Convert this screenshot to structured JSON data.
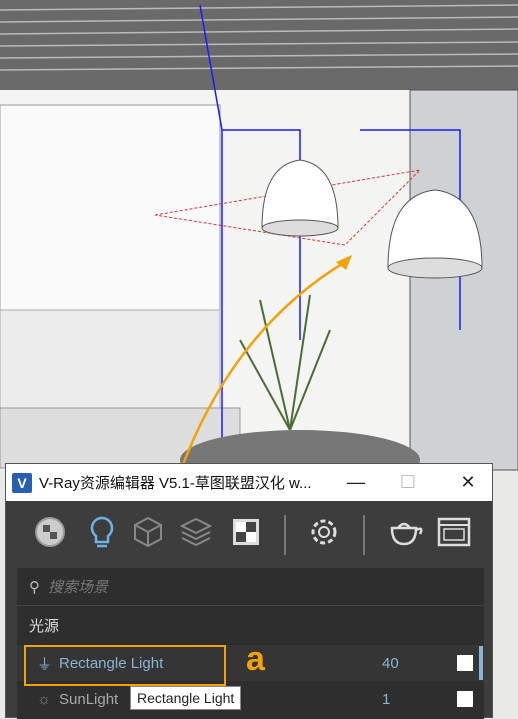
{
  "window": {
    "title": "V-Ray资源编辑器 V5.1-草图联盟汉化 w...",
    "minimize_icon": "minimize-icon",
    "maximize_icon": "maximize-icon",
    "close_icon": "close-icon"
  },
  "toolbar": {
    "buttons": [
      "materials-icon",
      "lights-icon",
      "geometry-icon",
      "layers-icon",
      "textures-icon",
      "settings-icon",
      "render-teapot-icon",
      "frame-buffer-icon"
    ],
    "accent": "#6cb4e4"
  },
  "search": {
    "placeholder": "搜索场景"
  },
  "category": "光源",
  "lights": [
    {
      "name": "Rectangle Light",
      "value": "40",
      "enabled": true,
      "icon": "rectangle-light-icon",
      "selected": true
    },
    {
      "name": "SunLight",
      "value": "1",
      "enabled": true,
      "icon": "sun-icon"
    }
  ],
  "annotation": {
    "label": "a",
    "color": "#f0a30a"
  },
  "tooltip": "Rectangle Light"
}
